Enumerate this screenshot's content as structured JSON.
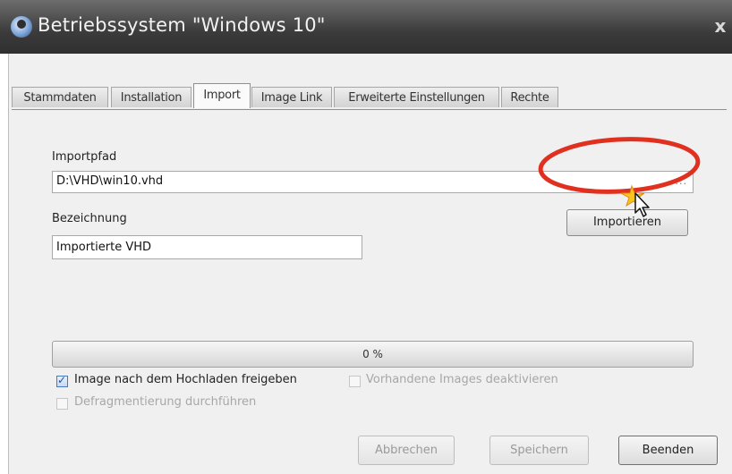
{
  "window": {
    "title": "Betriebssystem \"Windows 10\"",
    "close_glyph": "x"
  },
  "tabs": [
    {
      "label": "Stammdaten",
      "active": false
    },
    {
      "label": "Installation",
      "active": false
    },
    {
      "label": "Import",
      "active": true
    },
    {
      "label": "Image Link",
      "active": false
    },
    {
      "label": "Erweiterte Einstellungen",
      "active": false
    },
    {
      "label": "Rechte",
      "active": false
    }
  ],
  "import": {
    "path_label": "Importpfad",
    "path_value": "D:\\VHD\\win10.vhd",
    "browse_glyph": "...",
    "name_label": "Bezeichnung",
    "name_value": "Importierte VHD",
    "import_button": "Importieren",
    "progress_text": "0 %",
    "progress_percent": 0
  },
  "options": {
    "release_after_upload": {
      "label": "Image nach dem Hochladen freigeben",
      "checked": true,
      "enabled": true
    },
    "deactivate_existing": {
      "label": "Vorhandene Images deaktivieren",
      "checked": false,
      "enabled": false
    },
    "defragment": {
      "label": "Defragmentierung durchführen",
      "checked": false,
      "enabled": false
    }
  },
  "footer": {
    "cancel_button": "Abbrechen",
    "save_button": "Speichern",
    "close_button": "Beenden"
  },
  "icons": {
    "app": "app-logo-icon",
    "close": "close-icon",
    "cursor": "mouse-pointer-icon",
    "highlight": "red-highlight-ellipse"
  },
  "colors": {
    "title_bar": "#3b3b3b",
    "dialog_background": "#f0f0f0",
    "highlight": "#e03020",
    "checkbox_accent": "#1f4f9c"
  }
}
